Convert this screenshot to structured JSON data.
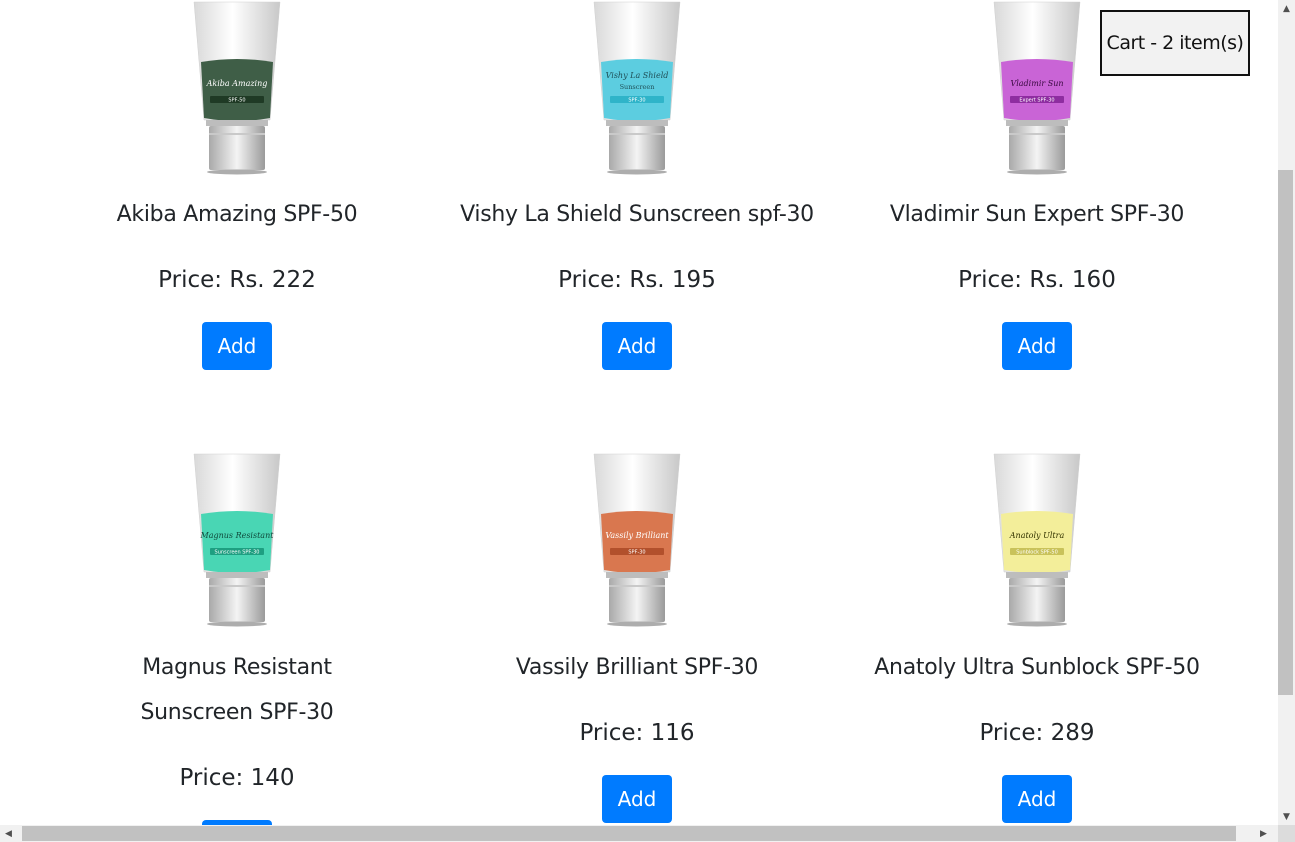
{
  "cart": {
    "label": "Cart - 2 item(s)"
  },
  "add_label": "Add",
  "products": [
    {
      "name": "Akiba Amazing SPF-50",
      "price": "Price: Rs. 222",
      "tube_label": "Akiba Amazing",
      "tube_sub": "SPF-50",
      "band_color": "#3f5e47",
      "sub_color": "#1f3a25",
      "label_color": "#ffffff"
    },
    {
      "name": "Vishy La Shield Sunscreen spf-30",
      "price": "Price: Rs. 195",
      "tube_label": "Vishy La Shield",
      "tube_label2": "Sunscreen",
      "tube_sub": "SPF-30",
      "band_color": "#5ccde0",
      "sub_color": "#2fb4c9",
      "label_color": "#1f4f57"
    },
    {
      "name": "Vladimir Sun Expert SPF-30",
      "price": "Price: Rs. 160",
      "tube_label": "Vladimir Sun",
      "tube_sub": "Expert SPF-30",
      "band_color": "#c964d6",
      "sub_color": "#8e2da0",
      "label_color": "#3a0a41"
    },
    {
      "name": "Magnus Resistant Sunscreen SPF-30",
      "price": "Price: 140",
      "tube_label": "Magnus Resistant",
      "tube_sub": "Sunscreen SPF-30",
      "band_color": "#49d6b4",
      "sub_color": "#1e9f81",
      "label_color": "#104a3c"
    },
    {
      "name": "Vassily Brilliant SPF-30",
      "price": "Price: 116",
      "tube_label": "Vassily Brilliant",
      "tube_sub": "SPF-30",
      "band_color": "#d9774f",
      "sub_color": "#b2502c",
      "label_color": "#ffffff"
    },
    {
      "name": "Anatoly Ultra Sunblock SPF-50",
      "price": "Price: 289",
      "tube_label": "Anatoly Ultra",
      "tube_sub": "Sunblock SPF-50",
      "band_color": "#f3ee9a",
      "sub_color": "#c9c25a",
      "label_color": "#333300"
    }
  ]
}
